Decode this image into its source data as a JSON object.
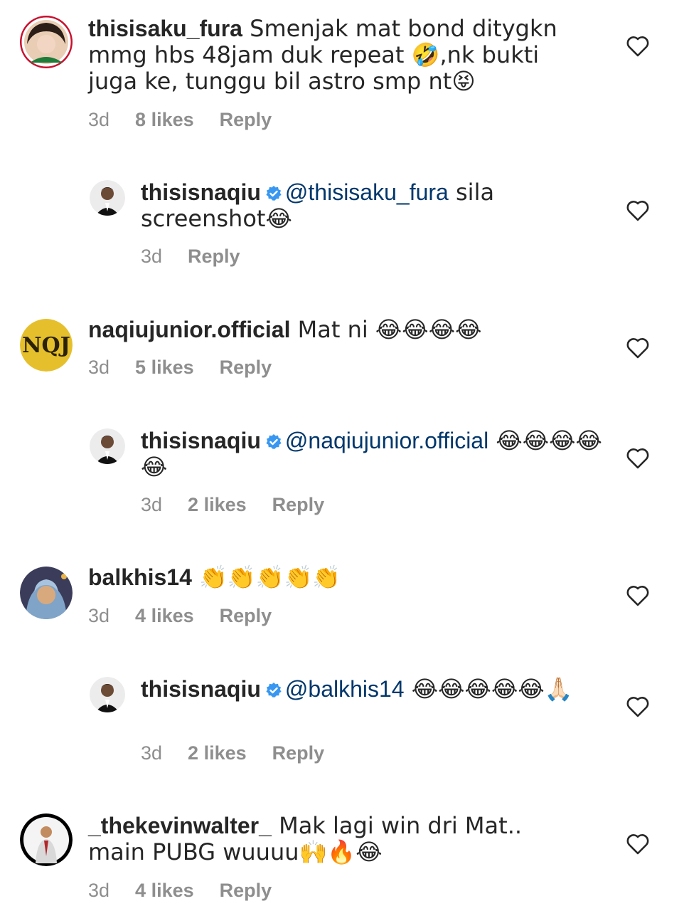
{
  "comments": [
    {
      "username": "thisisaku_fura",
      "body": " Smenjak mat bond ditygkn mmg hbs 48jam duk repeat 🤣,nk bukti juga ke, tunggu bil astro smp nt😝",
      "time": "3d",
      "likes": "8 likes",
      "reply": "Reply"
    },
    {
      "username": "thisisnaqiu",
      "mention": "@thisisaku_fura",
      "body": " sila screenshot😂",
      "time": "3d",
      "reply": "Reply"
    },
    {
      "username": "naqiujunior.official",
      "body": " Mat ni 😂😂😂😂",
      "time": "3d",
      "likes": "5 likes",
      "reply": "Reply"
    },
    {
      "username": "thisisnaqiu",
      "mention": "@naqiujunior.official",
      "body": " 😂😂😂😂😂",
      "time": "3d",
      "likes": "2 likes",
      "reply": "Reply"
    },
    {
      "username": "balkhis14",
      "body": " 👏👏👏👏👏",
      "time": "3d",
      "likes": "4 likes",
      "reply": "Reply"
    },
    {
      "username": "thisisnaqiu",
      "mention": "@balkhis14",
      "body": " 😂😂😂😂😂🙏🏻",
      "time": "3d",
      "likes": "2 likes",
      "reply": "Reply"
    },
    {
      "username": "_thekevinwalter_",
      "body": " Mak lagi win dri Mat.. main PUBG wuuuu🙌🔥😂",
      "time": "3d",
      "likes": "4 likes",
      "reply": "Reply"
    }
  ],
  "colors": {
    "text": "#262626",
    "meta": "#8e8e8e",
    "mention": "#00376b",
    "verified": "#3897f0"
  },
  "icons": {
    "like": "heart-outline-icon",
    "verified": "verified-badge-icon"
  }
}
